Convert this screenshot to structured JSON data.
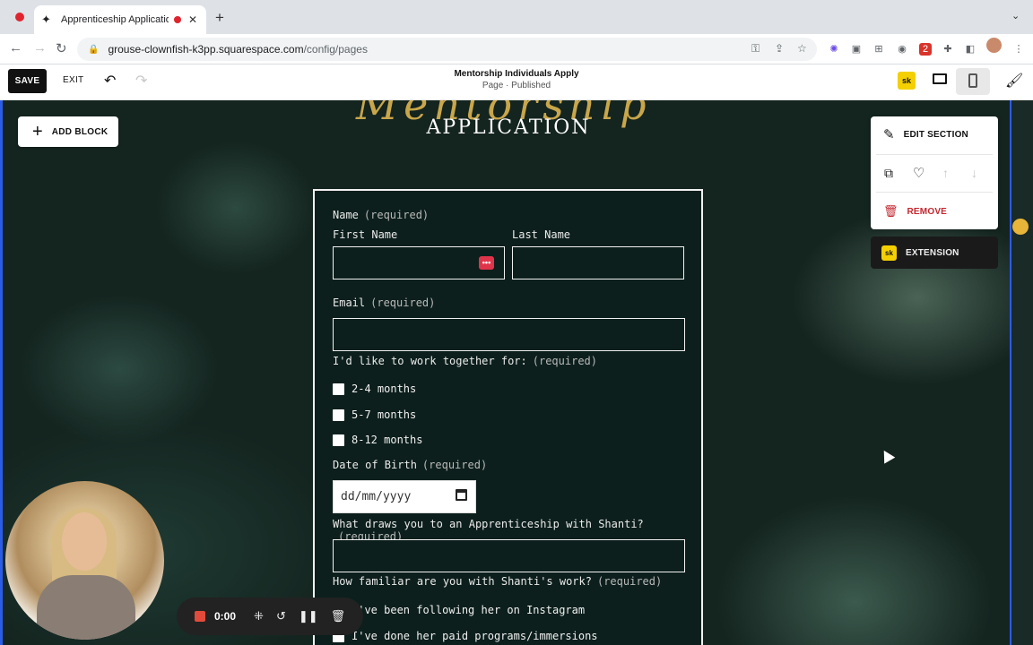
{
  "browser": {
    "tab_title": "Apprenticeship Application",
    "favicon": "✦",
    "url_domain": "grouse-clownfish-k3pp.squarespace.com",
    "url_path": "/config/pages",
    "ext_badge": "2",
    "icons": [
      "back-icon",
      "forward-icon",
      "reload-icon",
      "lock-icon",
      "key-icon",
      "share-icon",
      "star-icon",
      "extensions-puzzle-icon",
      "sidebar-icon",
      "profile-avatar",
      "kebab-menu-icon"
    ]
  },
  "editor": {
    "save_label": "SAVE",
    "exit_label": "EXIT",
    "page_title": "Mentorship Individuals Apply",
    "page_status": "Page · Published",
    "sk_badge": "sk"
  },
  "hero": {
    "script_text": "Mentorship",
    "subtitle": "APPLICATION"
  },
  "add_block_label": "ADD BLOCK",
  "form": {
    "name_label": "Name",
    "required": "(required)",
    "first_name": "First Name",
    "last_name": "Last Name",
    "pw_dots": "•••",
    "email_label": "Email",
    "work_label": "I'd like to work together for:",
    "work_options": [
      "2-4 months",
      "5-7 months",
      "8-12 months"
    ],
    "dob_label": "Date of Birth",
    "dob_placeholder": "dd/mm/yyyy",
    "draws_label": "What draws you to an Apprenticeship with Shanti?",
    "familiar_label": "How familiar are you with Shanti's work?",
    "familiar_options": [
      "I've been following her on Instagram",
      "I've done her paid programs/immersions"
    ]
  },
  "section_panel": {
    "edit_label": "EDIT SECTION",
    "remove_label": "REMOVE",
    "extension_label": "EXTENSION",
    "ext_sk": "sk",
    "remove_color": "#c3272f"
  },
  "recorder": {
    "time": "0:00"
  },
  "colors": {
    "brand_dark": "#111111",
    "selection_blue": "#2b5ce6",
    "sk_yellow": "#f4d000",
    "script_gold": "#c8a64a"
  }
}
